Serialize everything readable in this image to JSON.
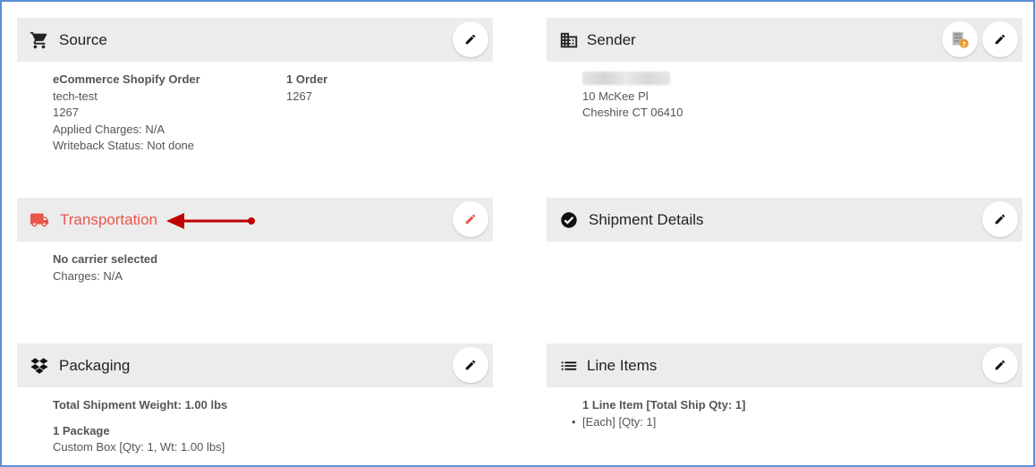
{
  "source": {
    "title": "Source",
    "order_type": "eCommerce Shopify Order",
    "store": "tech-test",
    "order_ref": "1267",
    "applied_charges": "Applied Charges: N/A",
    "writeback_status": "Writeback Status: Not done",
    "order_count": "1 Order",
    "order_number": "1267"
  },
  "sender": {
    "title": "Sender",
    "address1": "10 McKee Pl",
    "address2": "Cheshire CT 06410"
  },
  "transportation": {
    "title": "Transportation",
    "carrier": "No carrier selected",
    "charges": "Charges: N/A"
  },
  "shipment_details": {
    "title": "Shipment Details"
  },
  "packaging": {
    "title": "Packaging",
    "total_weight": "Total Shipment Weight: 1.00 lbs",
    "package_count": "1 Package",
    "package_detail": "Custom Box [Qty: 1, Wt: 1.00 lbs]"
  },
  "line_items": {
    "title": "Line Items",
    "summary": "1 Line Item [Total Ship Qty: 1]",
    "bullet": "•",
    "item": "[Each] [Qty: 1]"
  },
  "colors": {
    "accent_red": "#e8564c",
    "arrow_red": "#c00000",
    "header_bg": "#ececec",
    "frame_blue": "#5b8fd6"
  },
  "icons": {
    "source": "shopping-cart-icon",
    "sender": "building-icon",
    "transportation": "truck-icon",
    "shipment_details": "check-circle-icon",
    "packaging": "dropbox-icon",
    "line_items": "list-icon",
    "edit": "pencil-icon",
    "address_book": "address-book-help-icon"
  }
}
